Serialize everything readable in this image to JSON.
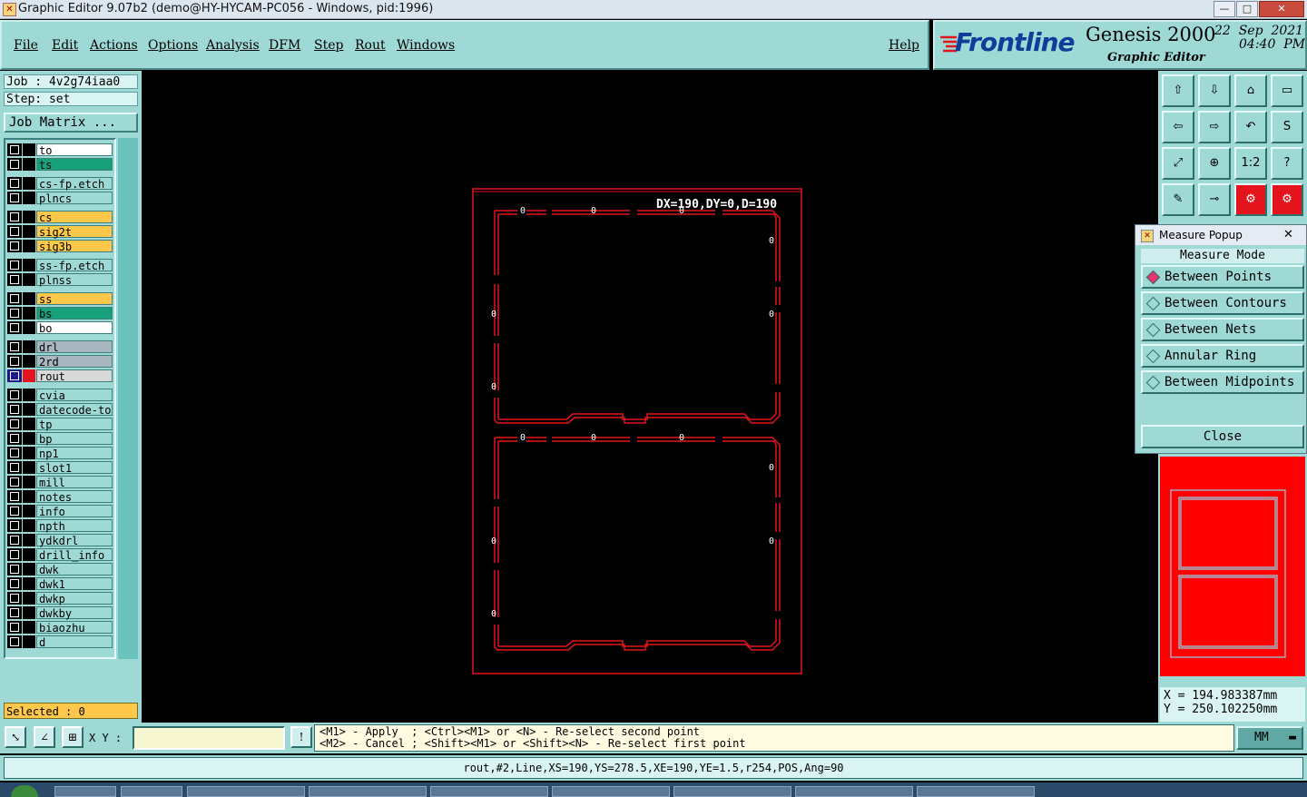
{
  "window": {
    "title": "Graphic Editor 9.07b2 (demo@HY-HYCAM-PC056 - Windows, pid:1996)",
    "minimize": "—",
    "maximize": "□",
    "close": "✕"
  },
  "menu": {
    "file": "File",
    "edit": "Edit",
    "actions": "Actions",
    "options": "Options",
    "analysis": "Analysis",
    "dfm": "DFM",
    "step": "Step",
    "rout": "Rout",
    "windows": "Windows",
    "help": "Help"
  },
  "logo": {
    "brand": "Frontline",
    "product": "Genesis 2000",
    "subtitle": "Graphic Editor",
    "date": "22  Sep  2021",
    "time": "04:40  PM"
  },
  "job": {
    "job_label": "Job : 4v2g74iaa0",
    "step_label": "Step:  set",
    "matrix_button": "Job Matrix ..."
  },
  "layers": [
    {
      "name": "to",
      "color": "#ffffff"
    },
    {
      "name": "ts",
      "color": "#17a07a"
    },
    {
      "name": "cs-fp.etch",
      "color": "#9ed9d6"
    },
    {
      "name": "plncs",
      "color": "#9ed9d6"
    },
    {
      "name": "cs",
      "color": "#ffc84a"
    },
    {
      "name": "sig2t",
      "color": "#ffc84a"
    },
    {
      "name": "sig3b",
      "color": "#ffc84a"
    },
    {
      "name": "ss-fp.etch",
      "color": "#9ed9d6"
    },
    {
      "name": "plnss",
      "color": "#9ed9d6"
    },
    {
      "name": "ss",
      "color": "#ffc84a"
    },
    {
      "name": "bs",
      "color": "#17a07a"
    },
    {
      "name": "bo",
      "color": "#ffffff"
    },
    {
      "name": "drl",
      "color": "#a8b7bf"
    },
    {
      "name": "2rd",
      "color": "#a8b7bf"
    },
    {
      "name": "rout",
      "color": "#d9d9d9"
    },
    {
      "name": "cvia",
      "color": "#9ed9d6"
    },
    {
      "name": "datecode-to",
      "color": "#9ed9d6"
    },
    {
      "name": "tp",
      "color": "#9ed9d6"
    },
    {
      "name": "bp",
      "color": "#9ed9d6"
    },
    {
      "name": "np1",
      "color": "#9ed9d6"
    },
    {
      "name": "slot1",
      "color": "#9ed9d6"
    },
    {
      "name": "mill",
      "color": "#9ed9d6"
    },
    {
      "name": "notes",
      "color": "#9ed9d6"
    },
    {
      "name": "info",
      "color": "#9ed9d6"
    },
    {
      "name": "npth",
      "color": "#9ed9d6"
    },
    {
      "name": "ydkdrl",
      "color": "#9ed9d6"
    },
    {
      "name": "drill_info",
      "color": "#9ed9d6"
    },
    {
      "name": "dwk",
      "color": "#9ed9d6"
    },
    {
      "name": "dwk1",
      "color": "#9ed9d6"
    },
    {
      "name": "dwkp",
      "color": "#9ed9d6"
    },
    {
      "name": "dwkby",
      "color": "#9ed9d6"
    },
    {
      "name": "biaozhu",
      "color": "#9ed9d6"
    },
    {
      "name": "d",
      "color": "#9ed9d6"
    }
  ],
  "active_layer": "rout",
  "selected": "Selected : 0",
  "measure": {
    "readout": "DX=190,DY=0,D=190",
    "popup_title": "Measure Popup",
    "mode_label": "Measure Mode",
    "options": [
      "Between Points",
      "Between Contours",
      "Between Nets",
      "Annular Ring",
      "Between Midpoints"
    ],
    "selected_option": "Between Points",
    "close_button": "Close"
  },
  "toolbar": {
    "zoom_1to2": "1:2",
    "help_q": "?"
  },
  "coords": {
    "x": "X  =  194.983387mm",
    "y": "Y  =  250.102250mm"
  },
  "bottom": {
    "xy_label": "X Y :",
    "xy_value": "",
    "hint_line1": "<M1> - Apply  ; <Ctrl><M1> or <N> - Re-select second point",
    "hint_line2": "<M2> - Cancel ; <Shift><M1> or <Shift><N> - Re-select first point",
    "units": "MM"
  },
  "status": "rout,#2,Line,XS=190,YS=278.5,XE=190,YE=1.5,r254,POS,Ang=90",
  "colors": {
    "panel": "#9ed9d6",
    "rout_line": "#e3141c",
    "minimap_bg": "#ff0000"
  },
  "icons": [
    "home-icon",
    "open-icon",
    "next-icon",
    "prev-icon",
    "zoom-fit-icon",
    "zoom-home-icon",
    "measure-icon",
    "ruler-icon",
    "color-icon",
    "layer-icon"
  ]
}
